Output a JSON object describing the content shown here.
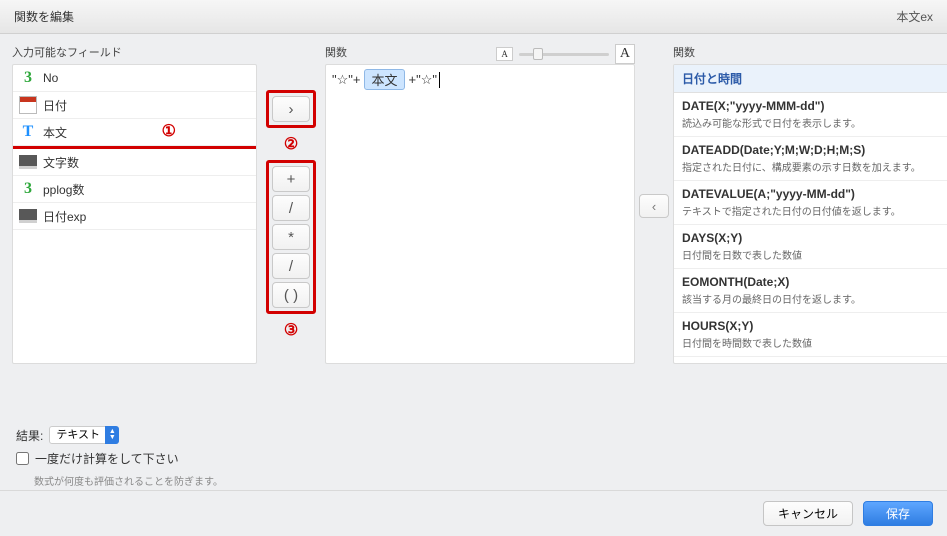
{
  "titlebar": {
    "title": "関数を編集",
    "subtitle": "本文ex"
  },
  "labels": {
    "fields": "入力可能なフィールド",
    "expr": "関数",
    "funcs": "関数",
    "small_a": "A",
    "big_a": "A"
  },
  "fields": [
    {
      "icon": "num",
      "name": "No"
    },
    {
      "icon": "date",
      "name": "日付"
    },
    {
      "icon": "text",
      "name": "本文"
    },
    {
      "icon": "calc",
      "name": "文字数"
    },
    {
      "icon": "num",
      "name": "pplog数"
    },
    {
      "icon": "calc",
      "name": "日付exp"
    }
  ],
  "annotations": {
    "one": "①",
    "two": "②",
    "three": "③"
  },
  "operators": {
    "go": "›",
    "plus": "+",
    "div1": "/",
    "mul": "*",
    "div2": "/",
    "paren": "( )"
  },
  "editor": {
    "prefix": "\"☆\"+",
    "token": "本文",
    "suffix": "+\"☆\""
  },
  "nav": {
    "back": "‹"
  },
  "func_section_header": "日付と時間",
  "functions": [
    {
      "name": "DATE(X;\"yyyy-MMM-dd\")",
      "desc": "読込み可能な形式で日付を表示します。"
    },
    {
      "name": "DATEADD(Date;Y;M;W;D;H;M;S)",
      "desc": "指定された日付に、構成要素の示す日数を加えます。"
    },
    {
      "name": "DATEVALUE(A;\"yyyy-MM-dd\")",
      "desc": "テキストで指定された日付の日付値を返します。"
    },
    {
      "name": "DAYS(X;Y)",
      "desc": "日付間を日数で表した数値"
    },
    {
      "name": "EOMONTH(Date;X)",
      "desc": "該当する月の最終日の日付を返します。"
    },
    {
      "name": "HOURS(X;Y)",
      "desc": "日付間を時間数で表した数値"
    }
  ],
  "result": {
    "label": "結果:",
    "selected": "テキスト",
    "checkbox_label": "一度だけ計算をして下さい",
    "hint": "数式が何度も評価されることを防ぎます。"
  },
  "footer": {
    "cancel": "キャンセル",
    "save": "保存"
  }
}
